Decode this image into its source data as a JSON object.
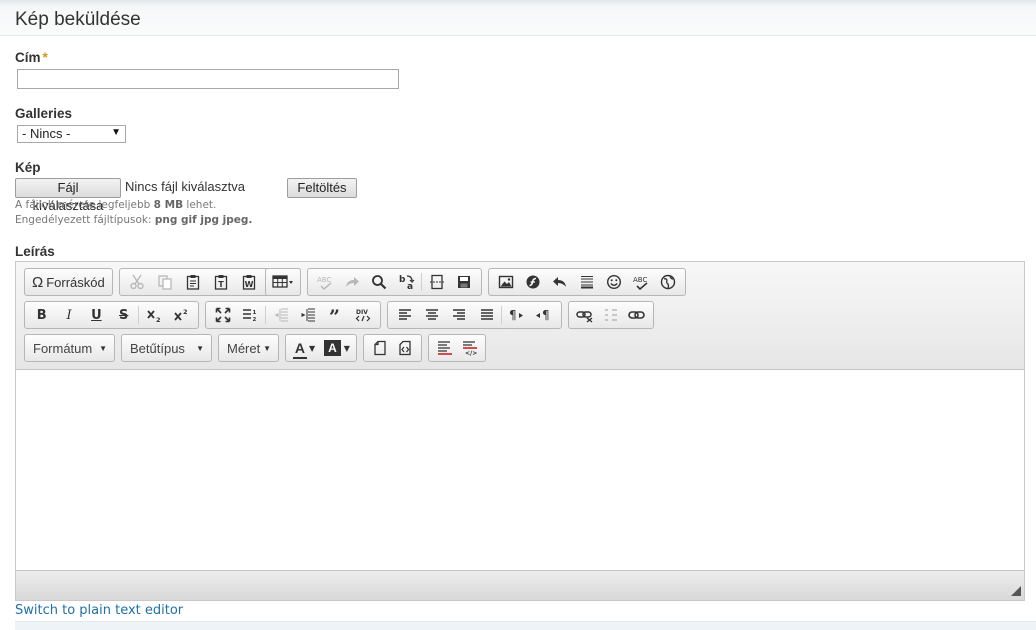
{
  "page": {
    "title": "Kép beküldése"
  },
  "form": {
    "title_field": {
      "label": "Cím",
      "required_mark": "*",
      "value": ""
    },
    "galleries": {
      "label": "Galleries",
      "selected": "- Nincs -"
    },
    "image": {
      "label": "Kép",
      "choose_button": "Fájl kiválasztása",
      "no_file_text": "Nincs fájl kiválasztva",
      "upload_button": "Feltöltés",
      "help_size_prefix": "A fájlok mérete legfeljebb",
      "help_size_value": "8 MB",
      "help_size_suffix": "lehet.",
      "help_types_prefix": "Engedélyezett fájltípusok:",
      "help_types_value": "png gif jpg jpeg",
      "help_types_suffix": "."
    },
    "description": {
      "label": "Leírás"
    }
  },
  "editor": {
    "source_button": "Forráskód",
    "format_combo": "Formátum",
    "font_combo": "Betűtípus",
    "size_combo": "Méret",
    "bold_glyph": "B",
    "italic_glyph": "I",
    "underline_glyph": "U",
    "strike_glyph": "S",
    "text_color_glyph": "A",
    "bg_color_glyph": "A"
  },
  "links": {
    "switch_plain": "Switch to plain text editor"
  }
}
